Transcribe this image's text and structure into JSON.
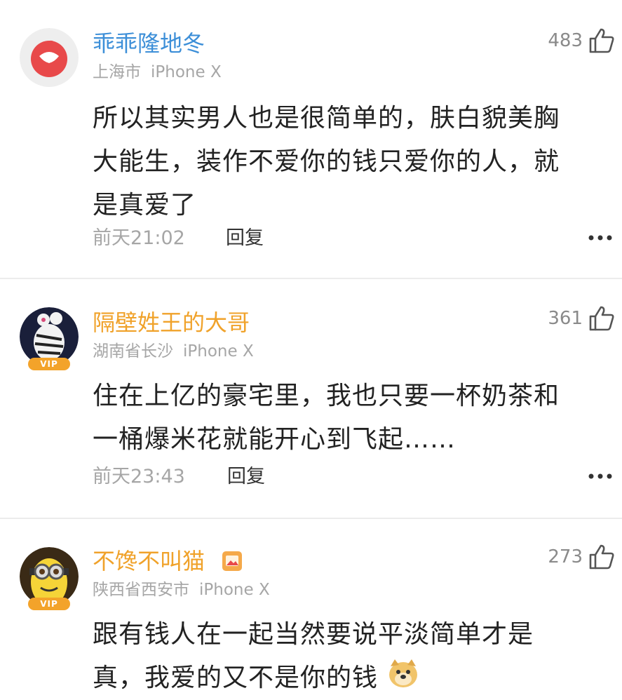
{
  "comments": [
    {
      "username": "乖乖隆地冬",
      "location": "上海市",
      "device": "iPhone X",
      "likes": "483",
      "lines": [
        "所以其实男人也是很简单的，肤白貌美胸",
        "大能生，装作不爱你的钱只爱你的人，就",
        "是真爱了"
      ],
      "time": "前天21:02",
      "reply": "回复"
    },
    {
      "username": "隔壁姓王的大哥",
      "location": "湖南省长沙",
      "device": "iPhone X",
      "likes": "361",
      "vip": "VIP",
      "lines": [
        "住在上亿的豪宅里，我也只要一杯奶茶和",
        "一桶爆米花就能开心到飞起……"
      ],
      "time": "前天23:43",
      "reply": "回复"
    },
    {
      "username": "不馋不叫猫",
      "location": "陕西省西安市",
      "device": "iPhone X",
      "likes": "273",
      "vip": "VIP",
      "lines": [
        "跟有钱人在一起当然要说平淡简单才是",
        "真，我爱的又不是你的钱"
      ]
    }
  ],
  "icons": {
    "like": "thumbs-up-icon",
    "more": "more-dots-icon",
    "badge": "picture-badge-icon",
    "emoji": "doge-emoji-icon"
  },
  "colors": {
    "username_blue": "#3d8fd8",
    "username_orange": "#f0a22a",
    "meta_gray": "#a6a6a6",
    "vip_gold": "#f3a32a"
  }
}
